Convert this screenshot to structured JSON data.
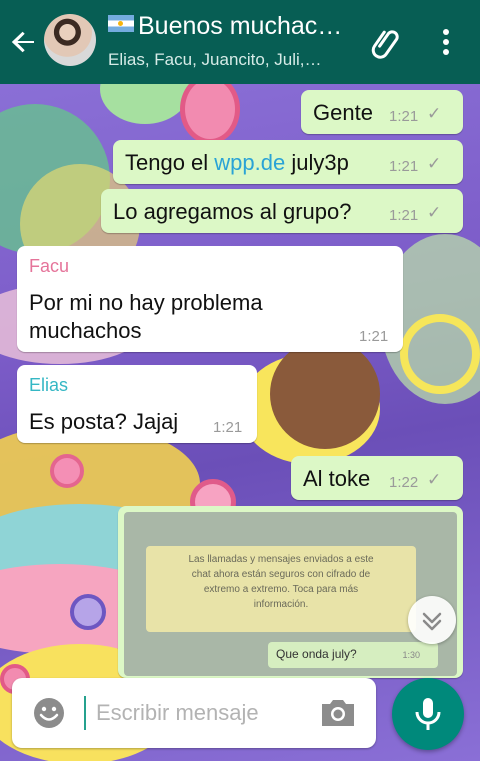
{
  "header": {
    "title": "Buenos muchac…",
    "subtitle": "Elias, Facu, Juancito, Juli,…",
    "flag_emoji_name": "argentina-flag"
  },
  "messages": [
    {
      "direction": "out",
      "text": "Gente",
      "time": "1:21"
    },
    {
      "direction": "out",
      "text_prefix": "Tengo el ",
      "link": "wpp.de",
      "text_suffix": " july3p",
      "time": "1:21"
    },
    {
      "direction": "out",
      "text": "Lo agregamos al grupo?",
      "time": "1:21"
    },
    {
      "direction": "in",
      "sender": "Facu",
      "sender_color": "#e5749a",
      "text_line1": "Por mi no hay problema",
      "text_line2": "muchachos",
      "time": "1:21"
    },
    {
      "direction": "in",
      "sender": "Elias",
      "sender_color": "#35b7c4",
      "text": "Es posta? Jajaj",
      "time": "1:21"
    },
    {
      "direction": "out",
      "text": "Al toke",
      "time": "1:22"
    },
    {
      "direction": "out",
      "type": "image",
      "image_note_line1": "Las llamadas y mensajes enviados a este",
      "image_note_line2": "chat ahora están seguros con cifrado de",
      "image_note_line3": "extremo a extremo. Toca para más",
      "image_note_line4": "información.",
      "image_bubble": "Que onda july?",
      "image_time": "1:30"
    }
  ],
  "input": {
    "placeholder": "Escribir mensaje"
  },
  "colors": {
    "header": "#075e54",
    "outgoing_bubble": "#dcf8c6",
    "incoming_bubble": "#ffffff",
    "mic_button": "#00897b"
  },
  "icons": [
    "back-arrow-icon",
    "attach-icon",
    "more-vert-icon",
    "check-icon",
    "emoji-icon",
    "camera-icon",
    "mic-icon",
    "chevron-double-down-icon"
  ]
}
